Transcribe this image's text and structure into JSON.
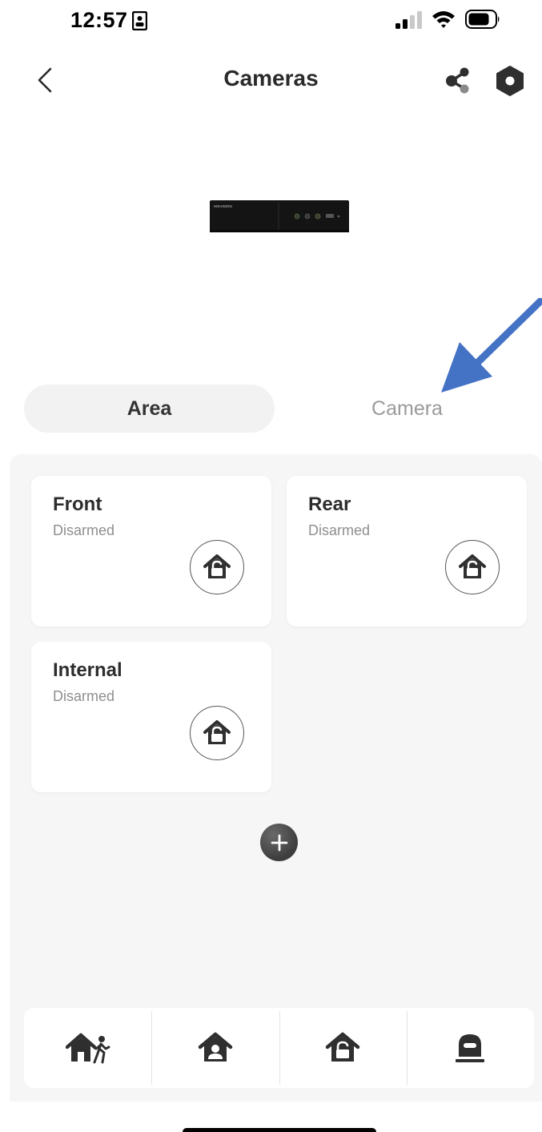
{
  "status_bar": {
    "time": "12:57",
    "icons": [
      "contact-card-icon",
      "cellular-signal-icon",
      "wifi-icon",
      "battery-icon"
    ]
  },
  "header": {
    "title": "Cameras",
    "back_icon": "chevron-left-icon",
    "share_icon": "share-icon",
    "settings_icon": "hexagon-settings-icon"
  },
  "device": {
    "brand_label": "HIKVISION"
  },
  "tabs": [
    {
      "label": "Area",
      "selected": true
    },
    {
      "label": "Camera",
      "selected": false
    }
  ],
  "areas": [
    {
      "name": "Front",
      "status": "Disarmed",
      "icon": "home-unlock-icon"
    },
    {
      "name": "Rear",
      "status": "Disarmed",
      "icon": "home-unlock-icon"
    },
    {
      "name": "Internal",
      "status": "Disarmed",
      "icon": "home-unlock-icon"
    }
  ],
  "add_area_icon": "plus-icon",
  "action_bar": [
    {
      "icon": "stay-arm-icon"
    },
    {
      "icon": "away-arm-icon"
    },
    {
      "icon": "disarm-icon"
    },
    {
      "icon": "clear-alarm-icon"
    }
  ],
  "colors": {
    "accent": "#4472c4",
    "panel_background": "#f6f6f6",
    "icon_dark": "#2f2f2f",
    "inactive_tab_text": "#9a9a9a"
  }
}
